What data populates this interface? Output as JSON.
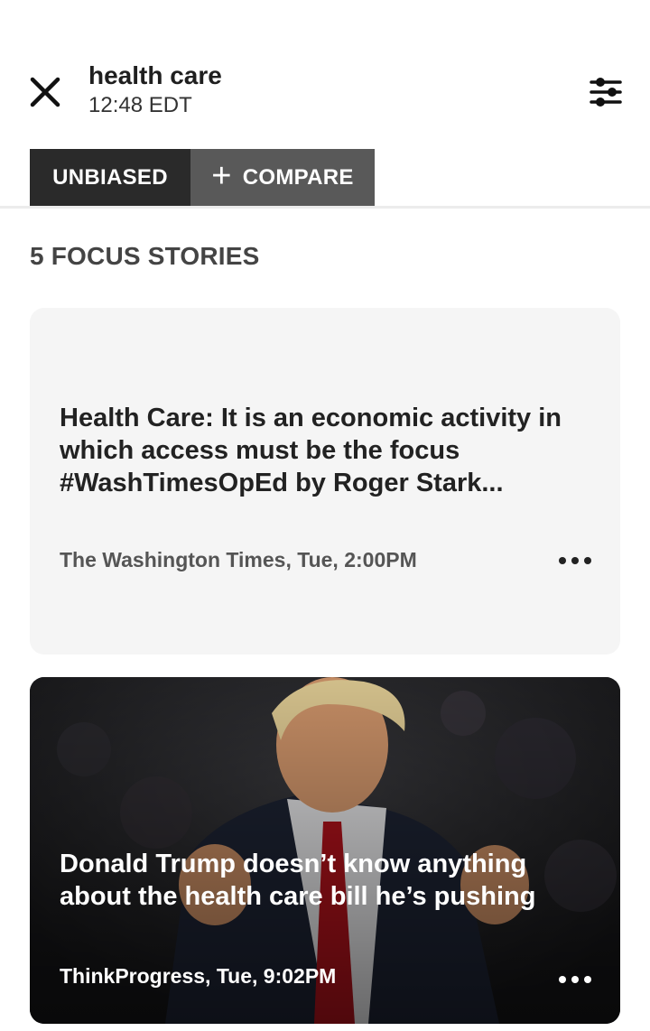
{
  "header": {
    "title": "health care",
    "time": "12:48 EDT",
    "close_icon": "close-icon",
    "filter_icon": "sliders-icon"
  },
  "toggles": {
    "unbiased_label": "UNBIASED",
    "compare_label": "COMPARE",
    "compare_icon": "+"
  },
  "section": {
    "title": "5 FOCUS STORIES"
  },
  "stories": [
    {
      "headline": "Health Care: It is an economic activity in which access must be the focus #WashTimesOpEd by Roger Stark...",
      "meta": "The Washington Times, Tue, 2:00PM",
      "has_image": false
    },
    {
      "headline": "Donald Trump doesn’t know anything about the health care bill he’s pushing",
      "meta": "ThinkProgress, Tue, 9:02PM",
      "has_image": true
    }
  ],
  "colors": {
    "toggle_active": "#2a2a2a",
    "toggle_inactive": "#595959",
    "card_bg": "#f5f5f5"
  }
}
